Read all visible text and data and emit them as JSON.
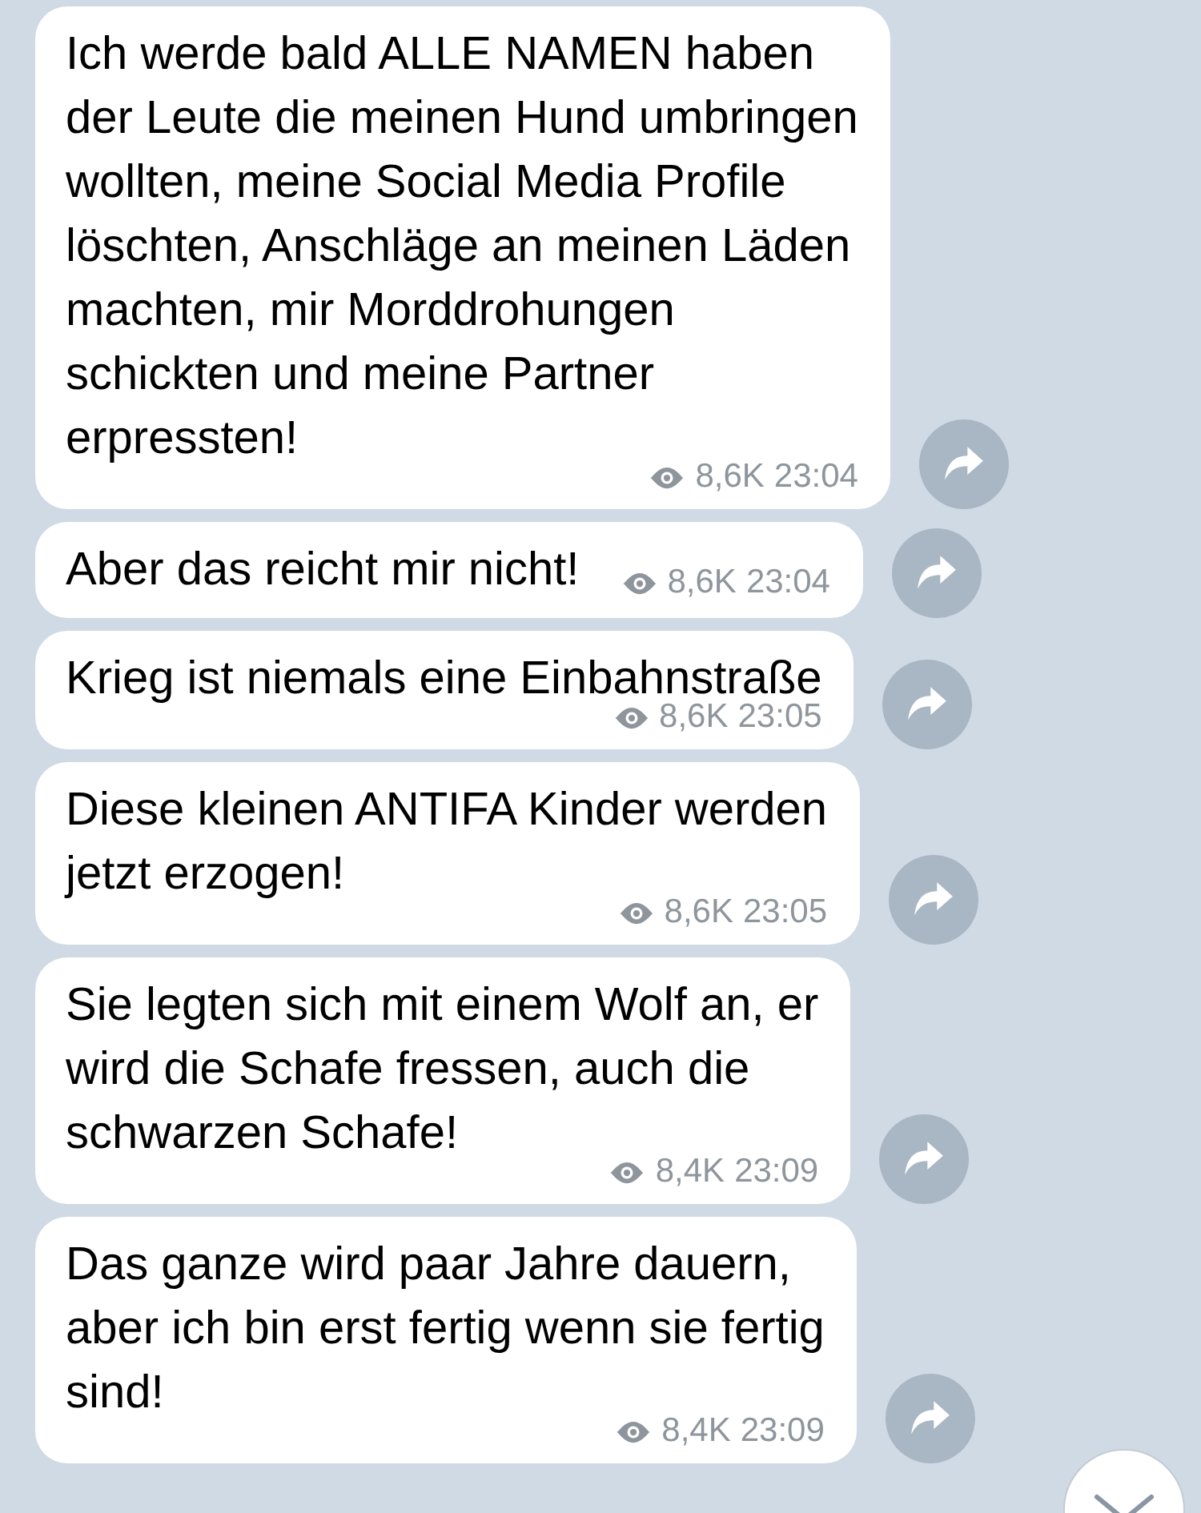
{
  "messages": [
    {
      "text": "Ich werde bald ALLE NAMEN haben\nder Leute die meinen Hund umbringen\nwollten, meine Social Media Profile\nlöschten, Anschläge an meinen Läden\nmachten, mir Morddrohungen\nschickten und meine Partner\nerpressten!",
      "views": "8,6K",
      "time": "23:04"
    },
    {
      "text": "Aber das reicht mir nicht!",
      "views": "8,6K",
      "time": "23:04"
    },
    {
      "text": "Krieg ist niemals eine Einbahnstraße",
      "views": "8,6K",
      "time": "23:05"
    },
    {
      "text": "Diese kleinen ANTIFA Kinder werden\njetzt erzogen!",
      "views": "8,6K",
      "time": "23:05"
    },
    {
      "text": "Sie legten sich mit einem Wolf an, er\nwird die Schafe fressen, auch die\nschwarzen Schafe!",
      "views": "8,4K",
      "time": "23:09"
    },
    {
      "text": "Das ganze wird paar Jahre dauern,\naber ich bin erst fertig wenn sie fertig\nsind!",
      "views": "8,4K",
      "time": "23:09"
    }
  ]
}
